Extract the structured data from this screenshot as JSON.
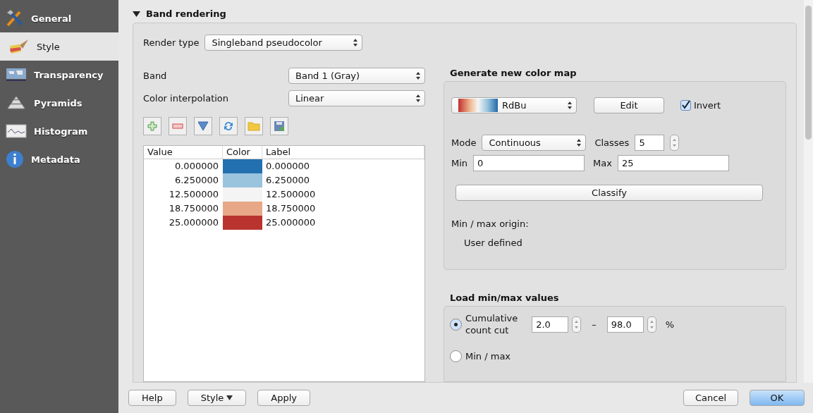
{
  "sidebar": {
    "items": [
      {
        "label": "General",
        "selected": false
      },
      {
        "label": "Style",
        "selected": true
      },
      {
        "label": "Transparency",
        "selected": false
      },
      {
        "label": "Pyramids",
        "selected": false
      },
      {
        "label": "Histogram",
        "selected": false
      },
      {
        "label": "Metadata",
        "selected": false
      }
    ]
  },
  "section": {
    "title": "Band rendering",
    "expanded": true
  },
  "render_type": {
    "label": "Render type",
    "value": "Singleband pseudocolor"
  },
  "band": {
    "label": "Band",
    "value": "Band 1 (Gray)"
  },
  "color_interpolation": {
    "label": "Color interpolation",
    "value": "Linear"
  },
  "table": {
    "columns": [
      "Value",
      "Color",
      "Label"
    ],
    "rows": [
      {
        "value": "0.000000",
        "color": "#2270b0",
        "label": "0.000000"
      },
      {
        "value": "6.250000",
        "color": "#9ac3dd",
        "label": "6.250000"
      },
      {
        "value": "12.500000",
        "color": "#f4f4f4",
        "label": "12.500000"
      },
      {
        "value": "18.750000",
        "color": "#e8a888",
        "label": "18.750000"
      },
      {
        "value": "25.000000",
        "color": "#b9342e",
        "label": "25.000000"
      }
    ]
  },
  "color_map": {
    "title": "Generate new color map",
    "ramp": "RdBu",
    "edit": "Edit",
    "invert": {
      "label": "Invert",
      "checked": true
    },
    "mode": {
      "label": "Mode",
      "value": "Continuous"
    },
    "classes": {
      "label": "Classes",
      "value": "5"
    },
    "min": {
      "label": "Min",
      "value": "0"
    },
    "max": {
      "label": "Max",
      "value": "25"
    },
    "classify": "Classify",
    "origin_label": "Min / max origin:",
    "origin_value": "User defined"
  },
  "load_minmax": {
    "title": "Load min/max values",
    "options": [
      {
        "label": "Cumulative\ncount cut",
        "selected": true,
        "from": "2.0",
        "dash": "–",
        "to": "98.0",
        "unit": "%"
      },
      {
        "label": "Min / max",
        "selected": false
      }
    ]
  },
  "footer": {
    "left": [
      "Help",
      "Style",
      "Apply"
    ],
    "right": [
      {
        "label": "Cancel",
        "default": false
      },
      {
        "label": "OK",
        "default": true
      }
    ]
  }
}
